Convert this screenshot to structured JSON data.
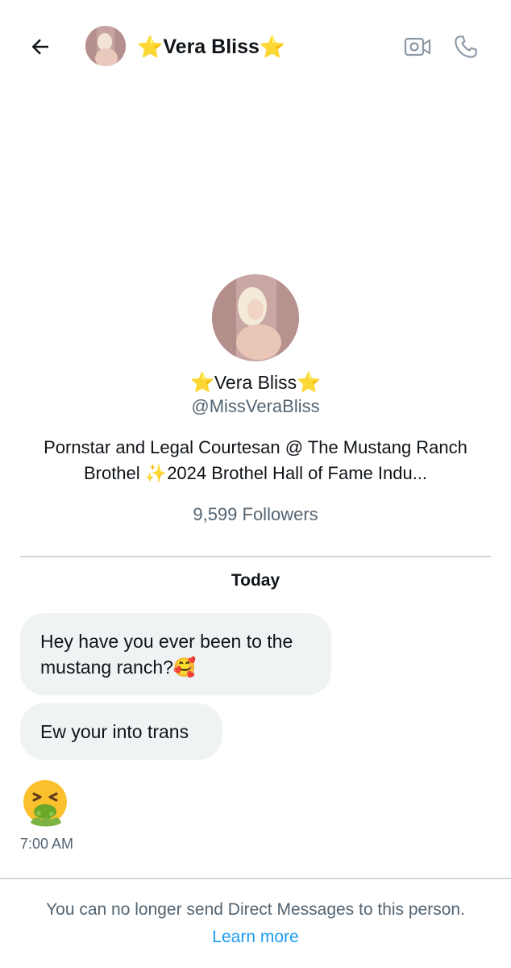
{
  "header": {
    "name": "Vera Bliss",
    "star": "⭐"
  },
  "profile": {
    "name": "Vera Bliss",
    "handle": "@MissVeraBliss",
    "bio_part1": "Pornstar and Legal Courtesan @ The Mustang Ranch Brothel ",
    "bio_sparkles": "✨",
    "bio_part2": "2024 Brothel Hall of Fame Indu...",
    "followers": "9,599 Followers"
  },
  "conversation": {
    "date_label": "Today",
    "messages": [
      {
        "text": "Hey have you ever been to the mustang ranch?🥰"
      },
      {
        "text": "Ew your into trans"
      }
    ],
    "emoji_message_icon": "vomiting-face-icon",
    "timestamp": "7:00 AM"
  },
  "footer": {
    "notice": "You can no longer send Direct Messages to this person.",
    "link": "Learn more"
  },
  "colors": {
    "bubble": "#eff3f4",
    "link": "#1d9bf0",
    "secondary_text": "#536471",
    "star": "#f5c518"
  }
}
